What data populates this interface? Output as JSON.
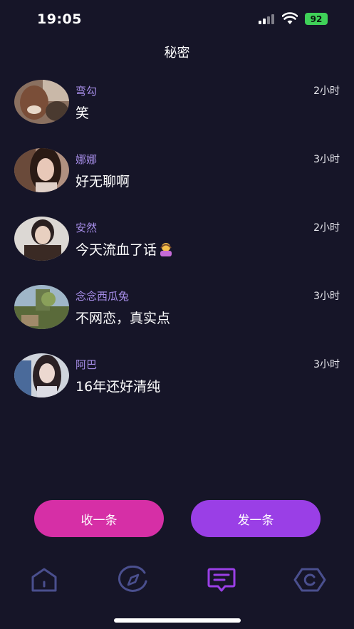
{
  "status_bar": {
    "time": "19:05",
    "battery": "92"
  },
  "header": {
    "title": "秘密"
  },
  "messages": [
    {
      "name": "弯勾",
      "time": "2小时",
      "text": "笑"
    },
    {
      "name": "娜娜",
      "time": "3小时",
      "text": "好无聊啊"
    },
    {
      "name": "安然",
      "time": "2小时",
      "text": "今天流血了话"
    },
    {
      "name": "念念西瓜兔",
      "time": "3小时",
      "text": "不网恋，真实点"
    },
    {
      "name": "阿巴",
      "time": "3小时",
      "text": "16年还好清纯"
    }
  ],
  "actions": {
    "receive_label": "收一条",
    "send_label": "发一条"
  },
  "tabbar": {
    "items": [
      {
        "icon": "home-icon"
      },
      {
        "icon": "compass-icon"
      },
      {
        "icon": "message-icon",
        "active": true
      },
      {
        "icon": "hexagon-c-icon"
      }
    ],
    "active_color": "#9a3fe6",
    "inactive_color": "#4a4f8e"
  },
  "colors": {
    "background": "#161528",
    "name": "#a68de8",
    "receive": "#d62fa6",
    "send": "#9a3fe6"
  }
}
